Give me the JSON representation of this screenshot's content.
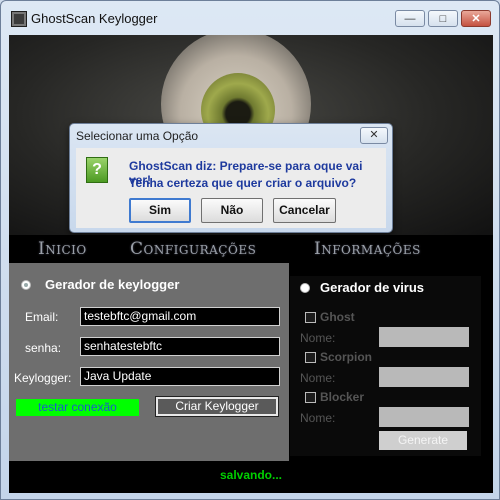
{
  "window": {
    "title": "GhostScan Keylogger",
    "minimize_glyph": "—",
    "maximize_glyph": "□",
    "close_glyph": "✕"
  },
  "menu": {
    "items": [
      "Inicio",
      "Configurações",
      "Informações"
    ]
  },
  "keylogger": {
    "section_label": "Gerador de keylogger",
    "email_label": "Email:",
    "email_value": "testebftc@gmail.com",
    "senha_label": "senha:",
    "senha_value": "senhatestebftc",
    "keylogger_label": "Keylogger:",
    "keylogger_value": "Java Update",
    "test_button": "testar conexão",
    "create_button": "Criar Keylogger"
  },
  "virus": {
    "section_label": "Gerador de virus",
    "options": [
      {
        "label": "Ghost",
        "nome_label": "Nome:"
      },
      {
        "label": "Scorpion",
        "nome_label": "Nome:"
      },
      {
        "label": "Blocker",
        "nome_label": "Nome:"
      }
    ],
    "generate_button": "Generate"
  },
  "status": {
    "text": "salvando..."
  },
  "dialog": {
    "title": "Selecionar uma Opção",
    "close_glyph": "✕",
    "icon_glyph": "?",
    "message_line1": "GhostScan diz: Prepare-se para oque vai ver!",
    "message_line2": "Tenha certeza que quer criar o arquivo?",
    "buttons": {
      "sim": "Sim",
      "nao": "Não",
      "cancelar": "Cancelar"
    }
  },
  "colors": {
    "status_green": "#00d000",
    "test_button_bg": "#00ff00",
    "dialog_text": "#1e3a9e"
  }
}
